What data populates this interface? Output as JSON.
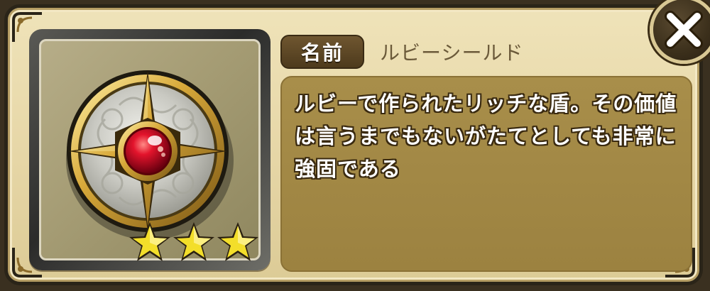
{
  "dialog": {
    "name_label": "名前",
    "item_name": "ルビーシールド",
    "description": "ルビーで作られたリッチな盾。その価値は言うまでもないがたてとしても非常に強固である"
  },
  "item": {
    "icon": "ruby-shield-icon",
    "rarity_stars": 3,
    "rarity_max": 3
  },
  "colors": {
    "panel_bg": "#e6d6a6",
    "desc_bg": "#a08646",
    "label_bg": "#5e4725",
    "star": "#f3de2a",
    "ruby": "#d9102a"
  },
  "close_button": {
    "icon": "close-icon"
  }
}
